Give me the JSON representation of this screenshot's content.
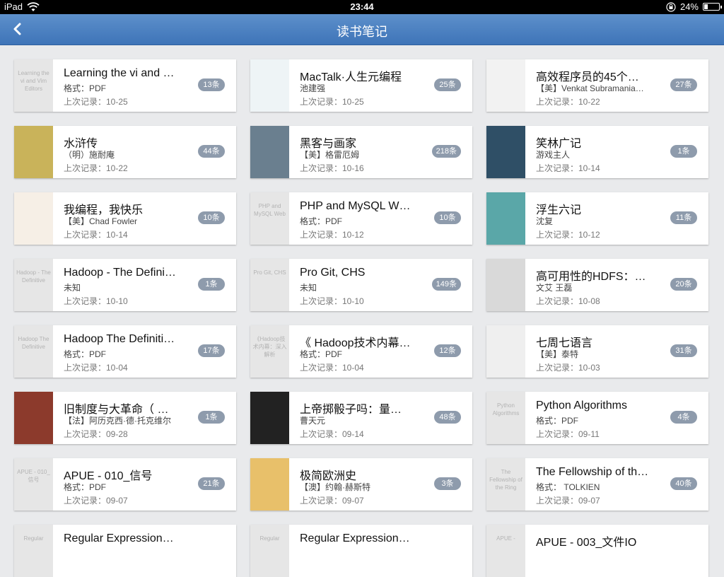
{
  "status_bar": {
    "device": "iPad",
    "time": "23:44",
    "battery": "24%",
    "battery_level": 0.24
  },
  "nav": {
    "title": "读书笔记",
    "back_icon": "chevron-left-icon"
  },
  "books": [
    {
      "title": "Learning the vi and …",
      "author": "格式：PDF",
      "date": "上次记录：10-25",
      "count": "13条",
      "cover_text": "Learning the vi and Vim Editors",
      "cover_color": ""
    },
    {
      "title": "MacTalk·人生元编程",
      "author": "池建强",
      "date": "上次记录：10-25",
      "count": "25条",
      "cover_text": "",
      "cover_color": "#eef4f6"
    },
    {
      "title": "高效程序员的45个…",
      "author": "【美】Venkat Subramania…",
      "date": "上次记录：10-22",
      "count": "27条",
      "cover_text": "",
      "cover_color": "#f2f2f2"
    },
    {
      "title": "水浒传",
      "author": "（明）施耐庵",
      "date": "上次记录：10-22",
      "count": "44条",
      "cover_text": "",
      "cover_color": "#c9b35a"
    },
    {
      "title": "黑客与画家",
      "author": "【美】格雷厄姆",
      "date": "上次记录：10-16",
      "count": "218条",
      "cover_text": "",
      "cover_color": "#6a7f8f"
    },
    {
      "title": "笑林广记",
      "author": "游戏主人",
      "date": "上次记录：10-14",
      "count": "1条",
      "cover_text": "",
      "cover_color": "#2f4f66"
    },
    {
      "title": "我编程，我快乐",
      "author": "【美】Chad Fowler",
      "date": "上次记录：10-14",
      "count": "10条",
      "cover_text": "",
      "cover_color": "#f6efe6"
    },
    {
      "title": "PHP and MySQL W…",
      "author": "格式：PDF",
      "date": "上次记录：10-12",
      "count": "10条",
      "cover_text": "PHP and MySQL Web",
      "cover_color": ""
    },
    {
      "title": "浮生六记",
      "author": "沈复",
      "date": "上次记录：10-12",
      "count": "11条",
      "cover_text": "",
      "cover_color": "#5aa7a8"
    },
    {
      "title": "Hadoop - The Defini…",
      "author": "未知",
      "date": "上次记录：10-10",
      "count": "1条",
      "cover_text": "Hadoop - The Definitive",
      "cover_color": ""
    },
    {
      "title": "Pro Git, CHS",
      "author": "未知",
      "date": "上次记录：10-10",
      "count": "149条",
      "cover_text": "Pro Git, CHS",
      "cover_color": ""
    },
    {
      "title": "高可用性的HDFS：…",
      "author": "文艾 王磊",
      "date": "上次记录：10-08",
      "count": "20条",
      "cover_text": "",
      "cover_color": "#d9d9d9"
    },
    {
      "title": "Hadoop The Definiti…",
      "author": "格式：PDF",
      "date": "上次记录：10-04",
      "count": "17条",
      "cover_text": "Hadoop The Definitive",
      "cover_color": ""
    },
    {
      "title": "《 Hadoop技术内幕…",
      "author": "格式：PDF",
      "date": "上次记录：10-04",
      "count": "12条",
      "cover_text": "《Hadoop技术内幕：深入解析",
      "cover_color": ""
    },
    {
      "title": "七周七语言",
      "author": "【美】泰特",
      "date": "上次记录：10-03",
      "count": "31条",
      "cover_text": "",
      "cover_color": "#efefef"
    },
    {
      "title": "旧制度与大革命（ …",
      "author": "【法】阿历克西·德·托克维尔",
      "date": "上次记录：09-28",
      "count": "1条",
      "cover_text": "",
      "cover_color": "#8c3a2c"
    },
    {
      "title": "上帝掷骰子吗：量…",
      "author": "曹天元",
      "date": "上次记录：09-14",
      "count": "48条",
      "cover_text": "",
      "cover_color": "#222222"
    },
    {
      "title": "Python Algorithms",
      "author": "格式：PDF",
      "date": "上次记录：09-11",
      "count": "4条",
      "cover_text": "Python Algorithms",
      "cover_color": ""
    },
    {
      "title": "APUE - 010_信号",
      "author": "格式：PDF",
      "date": "上次记录：09-07",
      "count": "21条",
      "cover_text": "APUE - 010_信号",
      "cover_color": ""
    },
    {
      "title": "极简欧洲史",
      "author": "【澳】约翰·赫斯特",
      "date": "上次记录：09-07",
      "count": "3条",
      "cover_text": "",
      "cover_color": "#e8c06a"
    },
    {
      "title": "The Fellowship of th…",
      "author": "格式： TOLKIEN",
      "date": "上次记录：09-07",
      "count": "40条",
      "cover_text": "The Fellowship of the Ring",
      "cover_color": ""
    },
    {
      "title": "Regular Expression…",
      "author": "",
      "date": "",
      "count": "",
      "cover_text": "Regular",
      "cover_color": ""
    },
    {
      "title": "Regular Expression…",
      "author": "",
      "date": "",
      "count": "",
      "cover_text": "Regular",
      "cover_color": ""
    },
    {
      "title": "APUE - 003_文件IO",
      "author": "",
      "date": "",
      "count": "",
      "cover_text": "APUE -",
      "cover_color": ""
    }
  ]
}
